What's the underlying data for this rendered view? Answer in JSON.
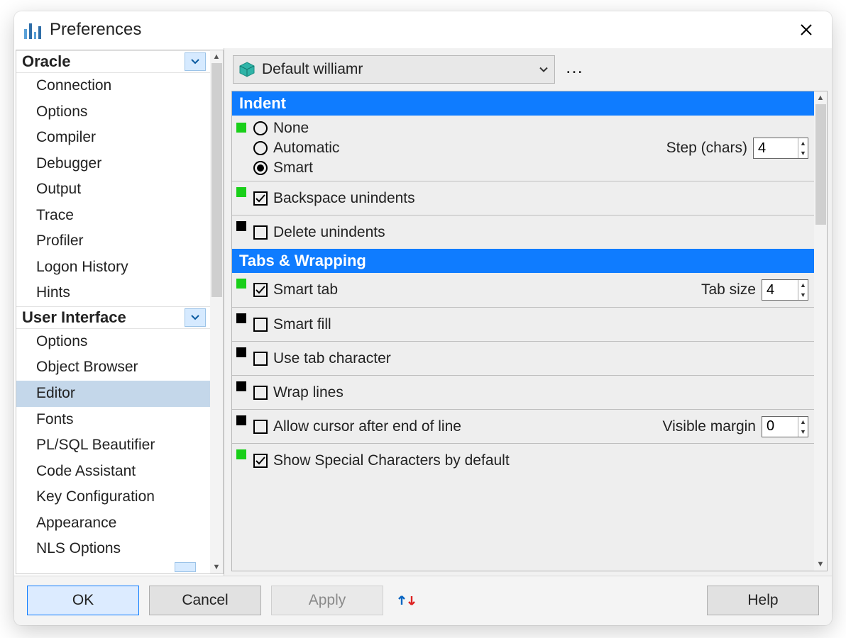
{
  "window": {
    "title": "Preferences"
  },
  "nav": {
    "categories": [
      {
        "label": "Oracle",
        "items": [
          "Connection",
          "Options",
          "Compiler",
          "Debugger",
          "Output",
          "Trace",
          "Profiler",
          "Logon History",
          "Hints"
        ]
      },
      {
        "label": "User Interface",
        "items": [
          "Options",
          "Object Browser",
          "Editor",
          "Fonts",
          "PL/SQL Beautifier",
          "Code Assistant",
          "Key Configuration",
          "Appearance",
          "NLS Options"
        ]
      }
    ],
    "selected": "Editor"
  },
  "profile": {
    "label": "Default williamr"
  },
  "sections": {
    "indent": {
      "title": "Indent",
      "options": {
        "none": "None",
        "auto": "Automatic",
        "smart": "Smart"
      },
      "selected": "smart",
      "step_label": "Step (chars)",
      "step_value": "4",
      "backspace": {
        "label": "Backspace unindents",
        "checked": true,
        "marker": "green"
      },
      "deleteun": {
        "label": "Delete unindents",
        "checked": false,
        "marker": "black"
      }
    },
    "tabs": {
      "title": "Tabs & Wrapping",
      "smarttab": {
        "label": "Smart tab",
        "checked": true,
        "marker": "green",
        "size_label": "Tab size",
        "size_value": "4"
      },
      "smartfill": {
        "label": "Smart fill",
        "checked": false,
        "marker": "black"
      },
      "usetab": {
        "label": "Use tab character",
        "checked": false,
        "marker": "black"
      },
      "wrap": {
        "label": "Wrap lines",
        "checked": false,
        "marker": "black"
      },
      "cursor": {
        "label": "Allow cursor after end of line",
        "checked": false,
        "marker": "black",
        "margin_label": "Visible margin",
        "margin_value": "0"
      },
      "special": {
        "label": "Show Special Characters by default",
        "checked": true,
        "marker": "green"
      }
    }
  },
  "footer": {
    "ok": "OK",
    "cancel": "Cancel",
    "apply": "Apply",
    "help": "Help"
  }
}
